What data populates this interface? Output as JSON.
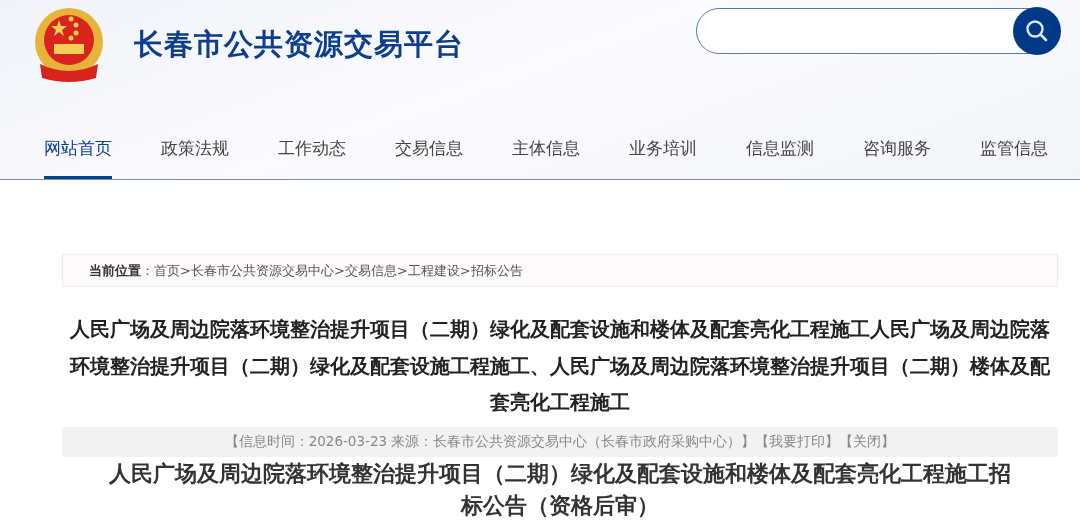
{
  "site": {
    "title": "长春市公共资源交易平台"
  },
  "nav": [
    {
      "label": "网站首页",
      "selected": true
    },
    {
      "label": "政策法规",
      "selected": false
    },
    {
      "label": "工作动态",
      "selected": false
    },
    {
      "label": "交易信息",
      "selected": false
    },
    {
      "label": "主体信息",
      "selected": false
    },
    {
      "label": "业务培训",
      "selected": false
    },
    {
      "label": "信息监测",
      "selected": false
    },
    {
      "label": "咨询服务",
      "selected": false
    },
    {
      "label": "监管信息",
      "selected": false
    }
  ],
  "breadcrumb": {
    "label": "当前位置",
    "separator": "：",
    "path": "首页>长春市公共资源交易中心>交易信息>工程建设>招标公告"
  },
  "article": {
    "title": "人民广场及周边院落环境整治提升项目（二期）绿化及配套设施和楼体及配套亮化工程施工人民广场及周边院落环境整治提升项目（二期）绿化及配套设施工程施工、人民广场及周边院落环境整治提升项目（二期）楼体及配套亮化工程施工",
    "meta": "【信息时间：2026-03-23 来源：长春市公共资源交易中心（长春市政府采购中心）】",
    "links": [
      "【我要打印】",
      "【关闭】"
    ],
    "doc_title": "人民广场及周边院落环境整治提升项目（二期）绿化及配套设施和楼体及配套亮化工程施工招标公告（资格后审）"
  }
}
